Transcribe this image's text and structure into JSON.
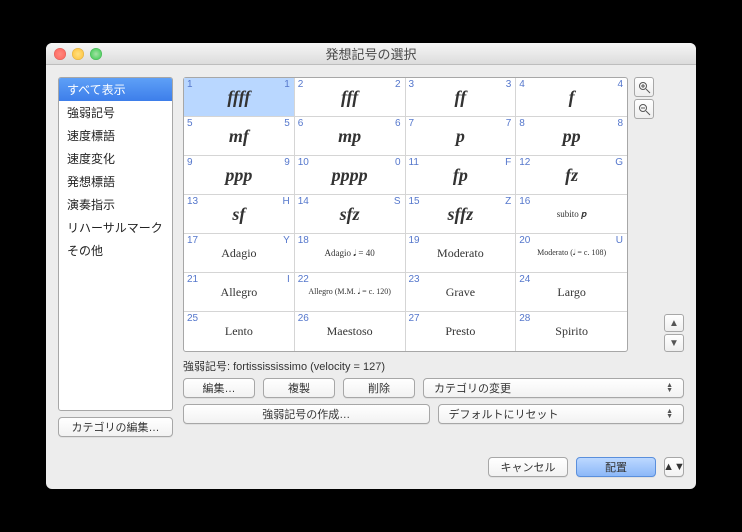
{
  "title": "発想記号の選択",
  "sidebar": {
    "items": [
      {
        "label": "すべて表示",
        "selected": true
      },
      {
        "label": "強弱記号"
      },
      {
        "label": "速度標語"
      },
      {
        "label": "速度変化"
      },
      {
        "label": "発想標語"
      },
      {
        "label": "演奏指示"
      },
      {
        "label": "リハーサルマーク"
      },
      {
        "label": "その他"
      }
    ],
    "editCategories": "カテゴリの編集…"
  },
  "grid": {
    "cells": [
      {
        "n": "1",
        "key": "1",
        "sym": "ffff",
        "cls": "dyn",
        "sel": true
      },
      {
        "n": "2",
        "key": "2",
        "sym": "fff",
        "cls": "dyn"
      },
      {
        "n": "3",
        "key": "3",
        "sym": "ff",
        "cls": "dyn"
      },
      {
        "n": "4",
        "key": "4",
        "sym": "f",
        "cls": "dyn"
      },
      {
        "n": "5",
        "key": "5",
        "sym": "mf",
        "cls": "dyn"
      },
      {
        "n": "6",
        "key": "6",
        "sym": "mp",
        "cls": "dyn"
      },
      {
        "n": "7",
        "key": "7",
        "sym": "p",
        "cls": "dyn"
      },
      {
        "n": "8",
        "key": "8",
        "sym": "pp",
        "cls": "dyn"
      },
      {
        "n": "9",
        "key": "9",
        "sym": "ppp",
        "cls": "dyn"
      },
      {
        "n": "10",
        "key": "0",
        "sym": "pppp",
        "cls": "dyn"
      },
      {
        "n": "11",
        "key": "F",
        "sym": "fp",
        "cls": "dyn"
      },
      {
        "n": "12",
        "key": "G",
        "sym": "fz",
        "cls": "dyn"
      },
      {
        "n": "13",
        "key": "H",
        "sym": "sf",
        "cls": "dyn"
      },
      {
        "n": "14",
        "key": "S",
        "sym": "sfz",
        "cls": "dyn"
      },
      {
        "n": "15",
        "key": "Z",
        "sym": "sffz",
        "cls": "dyn"
      },
      {
        "n": "16",
        "key": "",
        "sym": "subito 𝒑",
        "cls": "small"
      },
      {
        "n": "17",
        "key": "Y",
        "sym": "Adagio",
        "cls": "txt"
      },
      {
        "n": "18",
        "key": "",
        "sym": "Adagio  𝅘𝅥 = 40",
        "cls": "small"
      },
      {
        "n": "19",
        "key": "",
        "sym": "Moderato",
        "cls": "txt"
      },
      {
        "n": "20",
        "key": "U",
        "sym": "Moderato  (𝅘𝅥 = c. 108)",
        "cls": "tiny"
      },
      {
        "n": "21",
        "key": "I",
        "sym": "Allegro",
        "cls": "txt"
      },
      {
        "n": "22",
        "key": "",
        "sym": "Allegro  (M.M. 𝅘𝅥 = c. 120)",
        "cls": "tiny"
      },
      {
        "n": "23",
        "key": "",
        "sym": "Grave",
        "cls": "txt"
      },
      {
        "n": "24",
        "key": "",
        "sym": "Largo",
        "cls": "txt"
      },
      {
        "n": "25",
        "key": "",
        "sym": "Lento",
        "cls": "txt"
      },
      {
        "n": "26",
        "key": "",
        "sym": "Maestoso",
        "cls": "txt"
      },
      {
        "n": "27",
        "key": "",
        "sym": "Presto",
        "cls": "txt"
      },
      {
        "n": "28",
        "key": "",
        "sym": "Spirito",
        "cls": "txt"
      }
    ]
  },
  "status": "強弱記号: fortissississimo (velocity = 127)",
  "buttons": {
    "edit": "編集…",
    "dup": "複製",
    "del": "削除",
    "changeCategory": "カテゴリの変更",
    "createDynamic": "強弱記号の作成…",
    "resetDefault": "デフォルトにリセット",
    "cancel": "キャンセル",
    "place": "配置"
  }
}
